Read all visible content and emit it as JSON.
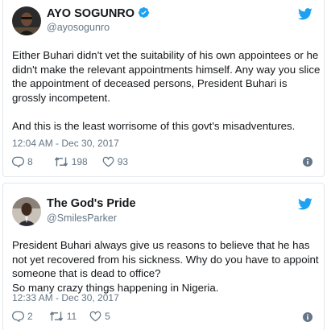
{
  "tweets": [
    {
      "author": {
        "name": "AYO SOGUNRO",
        "handle": "@ayosogunro",
        "verified": true
      },
      "paragraphs": [
        "Either Buhari didn't vet the suitability of his own appointees or he didn't make the relevant appointments himself. Any way you slice the appointment of deceased persons, President Buhari is grossly incompetent.",
        "And this is the least worrisome of this govt's misadventures."
      ],
      "timestamp": "12:04 AM - Dec 30, 2017",
      "replies": "8",
      "retweets": "198",
      "likes": "93"
    },
    {
      "author": {
        "name": "The God's Pride",
        "handle": "@SmilesParker",
        "verified": false
      },
      "paragraphs": [
        "President Buhari always give us reasons to believe that he has not yet recovered from his sickness. Why do you have to appoint someone that is dead to office?\nSo many crazy things happening in Nigeria."
      ],
      "timestamp": "12:33 AM - Dec 30, 2017",
      "replies": "2",
      "retweets": "11",
      "likes": "5"
    }
  ],
  "colors": {
    "twitter_blue": "#1da1f2",
    "text_primary": "#14171a",
    "text_secondary": "#657786",
    "border": "#e1e8ed"
  },
  "icons": {
    "reply": "reply-icon",
    "retweet": "retweet-icon",
    "like": "heart-icon",
    "info": "info-icon",
    "bird": "twitter-bird-icon",
    "verified": "verified-badge-icon"
  }
}
